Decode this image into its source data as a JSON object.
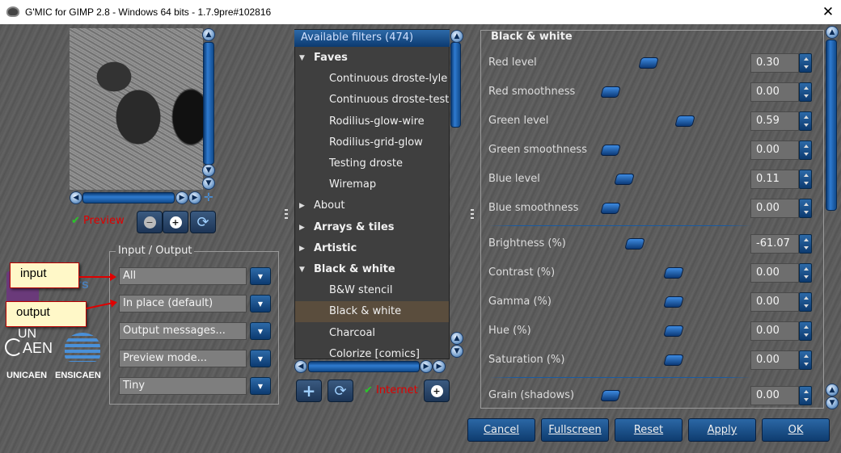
{
  "window": {
    "title": "G'MIC for GIMP 2.8 - Windows 64 bits - 1.7.9pre#102816",
    "close_glyph": "✕"
  },
  "preview": {
    "label": "Preview"
  },
  "io": {
    "title": "Input / Output",
    "fields": [
      {
        "name": "input-select",
        "value": "All"
      },
      {
        "name": "output-select",
        "value": "In place (default)"
      },
      {
        "name": "output-messages-select",
        "value": "Output messages..."
      },
      {
        "name": "preview-mode-select",
        "value": "Preview mode..."
      },
      {
        "name": "preview-size-select",
        "value": "Tiny"
      }
    ]
  },
  "callouts": {
    "input": "input",
    "output": "output"
  },
  "logos": {
    "unicaen": "UNICAEN",
    "ensicaen": "ENSICAEN",
    "unicaen_top": "UN",
    "unicaen_bottom": "AEN",
    "cnrs": "cnrs"
  },
  "filters": {
    "header": "Available filters (474)",
    "rows": [
      {
        "label": "Faves",
        "type": "cat",
        "open": true
      },
      {
        "label": "Continuous droste-lyle",
        "type": "item"
      },
      {
        "label": "Continuous droste-test",
        "type": "item"
      },
      {
        "label": "Rodilius-glow-wire",
        "type": "item"
      },
      {
        "label": "Rodilius-grid-glow",
        "type": "item"
      },
      {
        "label": "Testing droste",
        "type": "item"
      },
      {
        "label": "Wiremap",
        "type": "item"
      },
      {
        "label": "About",
        "type": "cat-normal",
        "open": false
      },
      {
        "label": "Arrays & tiles",
        "type": "cat",
        "open": false
      },
      {
        "label": "Artistic",
        "type": "cat",
        "open": false
      },
      {
        "label": "Black & white",
        "type": "cat",
        "open": true
      },
      {
        "label": "B&W stencil",
        "type": "item"
      },
      {
        "label": "Black & white",
        "type": "item",
        "selected": true
      },
      {
        "label": "Charcoal",
        "type": "item"
      },
      {
        "label": "Colorize [comics]",
        "type": "item"
      }
    ],
    "internet_label": "Internet"
  },
  "params": {
    "title": "Black & white",
    "rows": [
      {
        "label": "Red level",
        "value": "0.30",
        "pos": 0.3
      },
      {
        "label": "Red smoothness",
        "value": "0.00",
        "pos": 0.0
      },
      {
        "label": "Green level",
        "value": "0.59",
        "pos": 0.59
      },
      {
        "label": "Green smoothness",
        "value": "0.00",
        "pos": 0.0
      },
      {
        "label": "Blue level",
        "value": "0.11",
        "pos": 0.11
      },
      {
        "label": "Blue smoothness",
        "value": "0.00",
        "pos": 0.0
      },
      {
        "label": "Brightness (%)",
        "value": "-61.07",
        "pos": 0.19
      },
      {
        "label": "Contrast (%)",
        "value": "0.00",
        "pos": 0.5
      },
      {
        "label": "Gamma (%)",
        "value": "0.00",
        "pos": 0.5
      },
      {
        "label": "Hue (%)",
        "value": "0.00",
        "pos": 0.5
      },
      {
        "label": "Saturation (%)",
        "value": "0.00",
        "pos": 0.5
      },
      {
        "label": "Grain (shadows)",
        "value": "0.00",
        "pos": 0.0
      }
    ]
  },
  "buttons": {
    "cancel": "Cancel",
    "fullscreen": "Fullscreen",
    "reset": "Reset",
    "apply": "Apply",
    "ok": "OK"
  },
  "colors": {
    "accent": "#1f5fa8",
    "preview_label": "#e00000",
    "check": "#28c828"
  }
}
